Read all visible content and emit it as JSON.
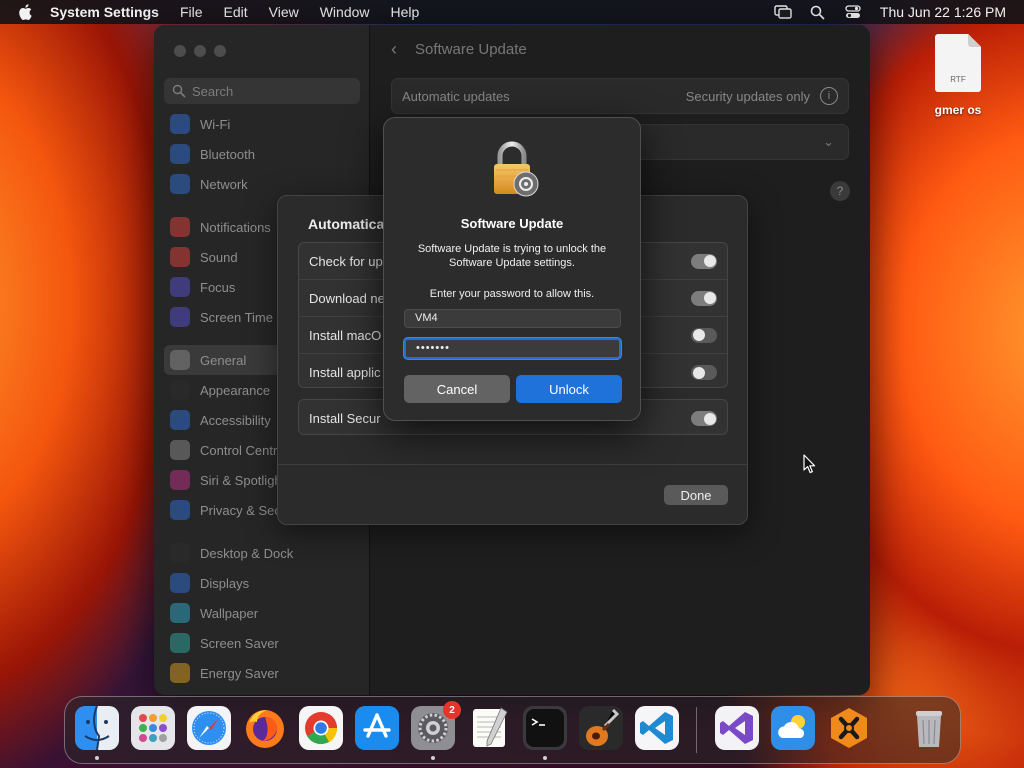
{
  "menubar": {
    "app_name": "System Settings",
    "menus": [
      "File",
      "Edit",
      "View",
      "Window",
      "Help"
    ],
    "clock": "Thu Jun 22  1:26 PM",
    "tray_icons": [
      "screen-mirroring-icon",
      "spotlight-search-icon",
      "control-center-icon"
    ]
  },
  "desktop": {
    "file_name": "gmer os",
    "file_type": "RTF"
  },
  "settings": {
    "search_placeholder": "Search",
    "sidebar": {
      "items": [
        {
          "label": "Wi-Fi",
          "icon": "wifi-icon",
          "color": "#2f6fd8"
        },
        {
          "label": "Bluetooth",
          "icon": "bluetooth-icon",
          "color": "#2f6fd8"
        },
        {
          "label": "Network",
          "icon": "network-icon",
          "color": "#2f6fd8"
        },
        {
          "label": "Notifications",
          "icon": "notifications-icon",
          "color": "#e0413a"
        },
        {
          "label": "Sound",
          "icon": "sound-icon",
          "color": "#e0413a"
        },
        {
          "label": "Focus",
          "icon": "focus-icon",
          "color": "#5a4fd0"
        },
        {
          "label": "Screen Time",
          "icon": "screen-time-icon",
          "color": "#5a4fd0"
        },
        {
          "label": "General",
          "icon": "gear-icon",
          "color": "#8a8a8a",
          "active": true
        },
        {
          "label": "Appearance",
          "icon": "appearance-icon",
          "color": "#2b2b2b"
        },
        {
          "label": "Accessibility",
          "icon": "accessibility-icon",
          "color": "#2f6fd8"
        },
        {
          "label": "Control Centre",
          "icon": "control-centre-icon",
          "color": "#8a8a8a"
        },
        {
          "label": "Siri & Spotlight",
          "icon": "siri-icon",
          "color": "#c0308a"
        },
        {
          "label": "Privacy & Security",
          "icon": "privacy-icon",
          "color": "#2f6fd8"
        },
        {
          "label": "Desktop & Dock",
          "icon": "desktop-dock-icon",
          "color": "#2b2b2b"
        },
        {
          "label": "Displays",
          "icon": "displays-icon",
          "color": "#2f6fd8"
        },
        {
          "label": "Wallpaper",
          "icon": "wallpaper-icon",
          "color": "#2fa8c8"
        },
        {
          "label": "Screen Saver",
          "icon": "screen-saver-icon",
          "color": "#2fa8a0"
        },
        {
          "label": "Energy Saver",
          "icon": "energy-saver-icon",
          "color": "#e0a020"
        }
      ]
    },
    "main": {
      "title": "Software Update",
      "auto_updates_label": "Automatic updates",
      "auto_updates_value": "Security updates only"
    }
  },
  "sheet": {
    "title": "Automatical",
    "rows": [
      {
        "label": "Check for up",
        "on": true
      },
      {
        "label": "Download ne",
        "on": true
      },
      {
        "label": "Install macO",
        "on": false
      },
      {
        "label": "Install applic",
        "on": false
      }
    ],
    "row_security": {
      "label": "Install Secur",
      "on": true
    },
    "done_label": "Done"
  },
  "auth": {
    "title": "Software Update",
    "message": "Software Update is trying to unlock the Software Update settings.",
    "prompt": "Enter your password to allow this.",
    "username": "VM4",
    "password_mask": "•••••••",
    "cancel_label": "Cancel",
    "unlock_label": "Unlock"
  },
  "dock": {
    "apps": [
      {
        "name": "Finder",
        "icon": "finder-icon",
        "running": true
      },
      {
        "name": "Launchpad",
        "icon": "launchpad-icon",
        "running": false
      },
      {
        "name": "Safari",
        "icon": "safari-icon",
        "running": false
      },
      {
        "name": "Firefox",
        "icon": "firefox-icon",
        "running": false
      },
      {
        "name": "Chrome",
        "icon": "chrome-icon",
        "running": false
      },
      {
        "name": "App Store",
        "icon": "app-store-icon",
        "running": false
      },
      {
        "name": "System Settings",
        "icon": "system-settings-icon",
        "running": true,
        "badge": "2"
      },
      {
        "name": "TextEdit",
        "icon": "textedit-icon",
        "running": false
      },
      {
        "name": "Terminal",
        "icon": "terminal-icon",
        "running": true
      },
      {
        "name": "GarageBand",
        "icon": "garageband-icon",
        "running": false
      },
      {
        "name": "Visual Studio Code",
        "icon": "vscode-icon",
        "running": false
      },
      {
        "name": "Visual Studio",
        "icon": "visual-studio-icon",
        "running": false
      },
      {
        "name": "Weather",
        "icon": "weather-icon",
        "running": false
      },
      {
        "name": "Xcode Tool",
        "icon": "x-app-icon",
        "running": false
      },
      {
        "name": "Trash",
        "icon": "trash-icon",
        "running": false
      }
    ]
  }
}
